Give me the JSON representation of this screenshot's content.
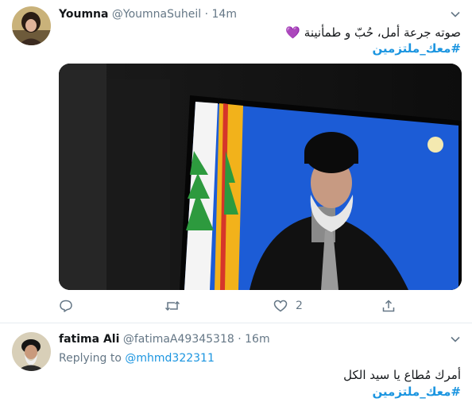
{
  "tweets": [
    {
      "name": "Youmna",
      "handle": "@YoumnaSuheil",
      "separator": "·",
      "time": "14m",
      "text": "صوته جرعة أمل، حُبّ و طمأنينة 💜",
      "hashtag": "#معك_ملتزمين",
      "likes": "2"
    },
    {
      "name": "fatima Ali",
      "handle": "@fatimaA49345318",
      "separator": "·",
      "time": "16m",
      "replying_prefix": "Replying to",
      "replying_to": "@mhmd322311",
      "text": "أمرك مُطاع يا سيد الكل",
      "hashtag": "#معك_ملتزمين"
    }
  ],
  "colors": {
    "accent": "#1b95e0",
    "muted": "#657786",
    "border": "#e6ecf0"
  }
}
